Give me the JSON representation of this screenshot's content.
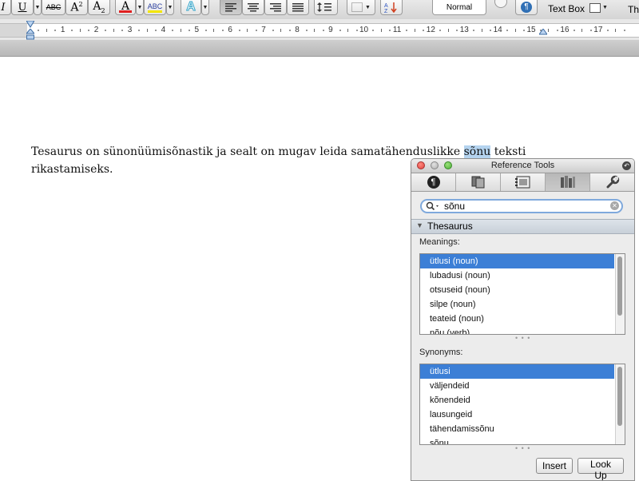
{
  "toolbar": {
    "italic_label": "I",
    "underline_label": "U",
    "strikethrough_label": "ABC",
    "superscript_label": "A",
    "superscript_mark": "2",
    "subscript_label": "A",
    "subscript_mark": "2",
    "font_color_label": "A",
    "highlight_label": "ABC",
    "text_effects_label": "A",
    "style_label": "Normal",
    "text_box_label": "Text Box",
    "themes_label": "Th",
    "colors": {
      "font_color": "#e02020",
      "highlight": "#f3e600",
      "accent": "#3c7fd6"
    }
  },
  "ruler": {
    "numbers": [
      "1",
      "2",
      "3",
      "4",
      "5",
      "6",
      "7",
      "8",
      "9",
      "10",
      "11",
      "12",
      "13",
      "14",
      "15",
      "16",
      "17"
    ]
  },
  "document": {
    "text_before": "Tesaurus on sünonüümisõnastik ja sealt on mugav leida samatähenduslikke ",
    "selected_word": "sõnu",
    "text_after": " teksti rikastamiseks."
  },
  "panel": {
    "title": "Reference Tools",
    "tabs": [
      "paragraph-icon",
      "scrapbook-icon",
      "citations-icon",
      "reference-books-icon",
      "wrench-icon"
    ],
    "active_tab": "reference-books-icon",
    "search": {
      "value": "sõnu"
    },
    "thesaurus_label": "Thesaurus",
    "meanings_label": "Meanings:",
    "meanings": [
      "ütlusi (noun)",
      "lubadusi (noun)",
      "otsuseid (noun)",
      "silpe (noun)",
      "teateid (noun)",
      "nõu (verb)"
    ],
    "synonyms_label": "Synonyms:",
    "synonyms": [
      "ütlusi",
      "väljendeid",
      "kõnendeid",
      "lausungeid",
      "tähendamissõnu",
      "sõnu"
    ],
    "insert_label": "Insert",
    "lookup_label": "Look Up"
  }
}
